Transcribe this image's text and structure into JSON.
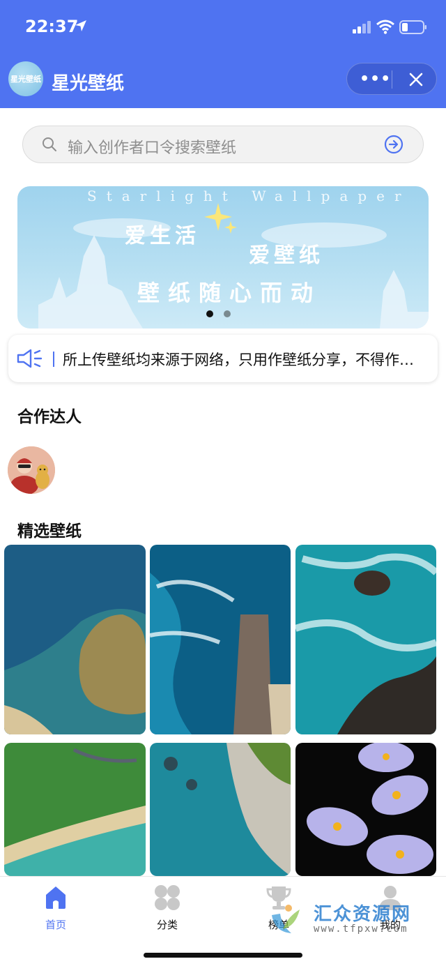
{
  "status_bar": {
    "time": "22:37"
  },
  "navbar": {
    "logo_text": "星光壁纸",
    "title": "星光壁纸",
    "more_label": "•••"
  },
  "search": {
    "placeholder": "输入创作者口令搜索壁纸"
  },
  "banner": {
    "english": "Starlight Wallpaper",
    "line1": "爱生活",
    "line2": "爱壁纸",
    "line3": "壁纸随心而动",
    "page_count": 2,
    "active_index": 0
  },
  "notice": {
    "text": "所上传壁纸均来源于网络，只用作壁纸分享，不得作…"
  },
  "partners": {
    "title": "合作达人"
  },
  "featured": {
    "title": "精选壁纸"
  },
  "tabbar": {
    "items": [
      {
        "label": "首页",
        "icon": "home-icon",
        "active": true
      },
      {
        "label": "分类",
        "icon": "category-icon",
        "active": false
      },
      {
        "label": "榜单",
        "icon": "trophy-icon",
        "active": false
      },
      {
        "label": "我的",
        "icon": "profile-icon",
        "active": false
      }
    ]
  },
  "watermark": {
    "cn": "汇众资源网",
    "url": "www.tfpxw.com"
  },
  "colors": {
    "brand": "#4f73f1",
    "tab_inactive": "#c8c8c8"
  }
}
